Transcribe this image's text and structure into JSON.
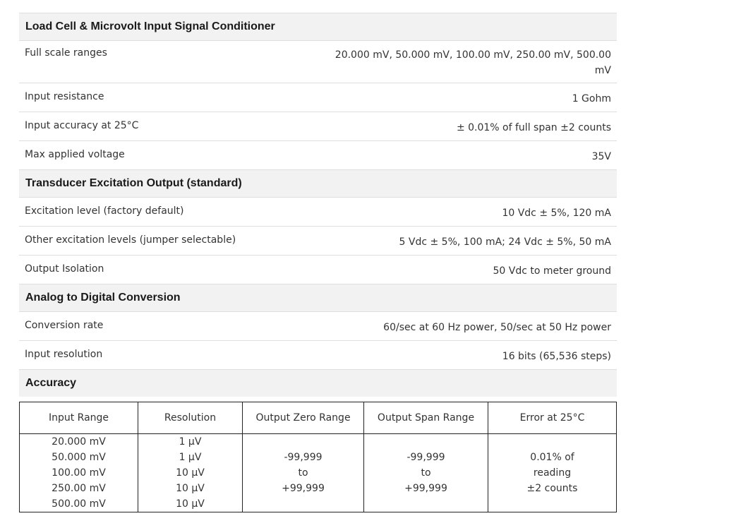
{
  "sections": [
    {
      "title": "Load Cell & Microvolt Input Signal Conditioner",
      "rows": [
        {
          "label": "Full scale ranges",
          "value": "20.000 mV, 50.000 mV, 100.00 mV, 250.00 mV, 500.00 mV"
        },
        {
          "label": "Input resistance",
          "value": "1 Gohm"
        },
        {
          "label": "Input accuracy at 25°C",
          "value": "± 0.01% of full span ±2 counts"
        },
        {
          "label": "Max applied voltage",
          "value": "35V"
        }
      ]
    },
    {
      "title": "Transducer Excitation Output (standard)",
      "rows": [
        {
          "label": "Excitation level (factory default)",
          "value": "10 Vdc ± 5%, 120 mA"
        },
        {
          "label": "Other excitation levels (jumper selectable)",
          "value": "5 Vdc ± 5%, 100 mA; 24 Vdc ± 5%, 50 mA"
        },
        {
          "label": "Output Isolation",
          "value": "50 Vdc to meter ground"
        }
      ]
    },
    {
      "title": "Analog to Digital Conversion",
      "rows": [
        {
          "label": "Conversion rate",
          "value": "60/sec at 60 Hz power, 50/sec at 50 Hz power"
        },
        {
          "label": "Input resolution",
          "value": "16 bits (65,536 steps)"
        }
      ]
    },
    {
      "title": "Accuracy",
      "rows": []
    }
  ],
  "accuracy_table": {
    "headers": [
      "Input Range",
      "Resolution",
      "Output Zero Range",
      "Output Span Range",
      "Error at 25°C"
    ],
    "input_ranges": [
      "20.000 mV",
      "50.000 mV",
      "100.00 mV",
      "250.00 mV",
      "500.00 mV"
    ],
    "resolutions": [
      "1 µV",
      "1 µV",
      "10 µV",
      "10 µV",
      "10 µV"
    ],
    "output_zero": [
      "-99,999",
      "to",
      "+99,999"
    ],
    "output_span": [
      "-99,999",
      "to",
      "+99,999"
    ],
    "error": [
      "0.01% of",
      "reading",
      "±2 counts"
    ]
  }
}
